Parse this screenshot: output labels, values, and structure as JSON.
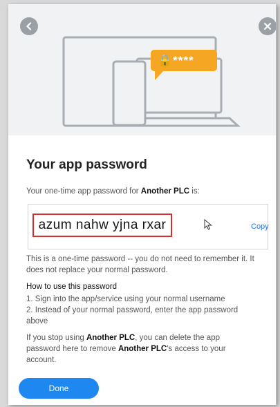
{
  "header": {
    "back_icon": "chevron-left-icon",
    "close_icon": "close-icon",
    "illustration_badge": "🔒****"
  },
  "dialog": {
    "title": "Your app password",
    "intro_prefix": "Your one-time app password for ",
    "company": "Another PLC",
    "intro_suffix": " is:",
    "password": "azum nahw yjna rxar",
    "copy_label": "Copy",
    "note": "This is a one-time password -- you do not need to remember it. It does not replace your normal password.",
    "howto_heading": "How to use this password",
    "step1": "1. Sign into the app/service using your normal username",
    "step2": "2. Instead of your normal password, enter the app password above",
    "stop_prefix": "If you stop using ",
    "stop_middle": ", you can delete the app password here to remove ",
    "stop_suffix": "'s access to your account.",
    "done_label": "Done"
  },
  "colors": {
    "accent": "#1e88f0",
    "highlight_border": "#d42f2f",
    "badge": "#f5a623"
  }
}
